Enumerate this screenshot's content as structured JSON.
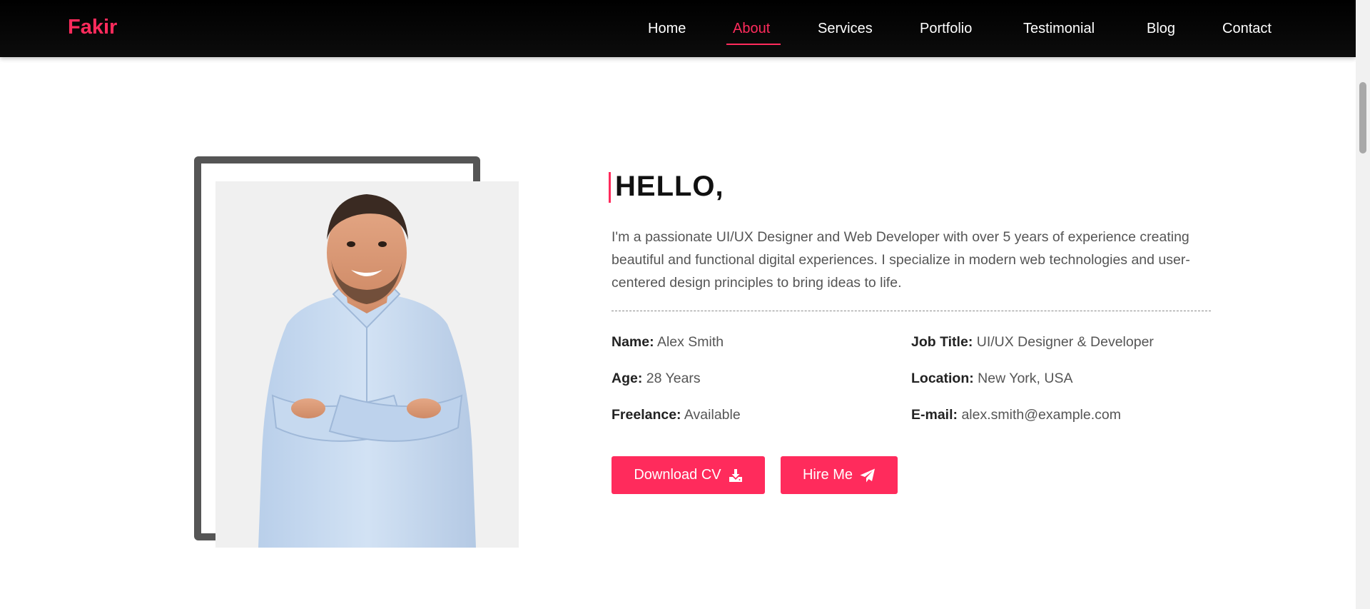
{
  "nav": {
    "logo": "Fakir",
    "links": [
      "Home",
      "About",
      "Services",
      "Portfolio",
      "Testimonial",
      "Blog",
      "Contact"
    ],
    "active": "About"
  },
  "about": {
    "greeting": "HELLO,",
    "bio": "I'm a passionate UI/UX Designer and Web Developer with over 5 years of experience creating beautiful and functional digital experiences. I specialize in modern web technologies and user-centered design principles to bring ideas to life.",
    "info": {
      "name": {
        "label": "Name:",
        "value": "Alex Smith"
      },
      "job_title": {
        "label": "Job Title:",
        "value": "UI/UX Designer & Developer"
      },
      "age": {
        "label": "Age:",
        "value": "28 Years"
      },
      "location": {
        "label": "Location:",
        "value": "New York, USA"
      },
      "freelance": {
        "label": "Freelance:",
        "value": "Available"
      },
      "email": {
        "label": "E-mail:",
        "value": "alex.smith@example.com"
      }
    },
    "buttons": {
      "download_cv": "Download CV",
      "hire_me": "Hire Me"
    },
    "icons": {
      "download": "download-icon",
      "hire": "paper-plane-icon"
    }
  },
  "colors": {
    "accent": "#ff2b5c",
    "navbar": "#000000",
    "frame": "#555555",
    "photo_bg": "#f0f0f0"
  }
}
